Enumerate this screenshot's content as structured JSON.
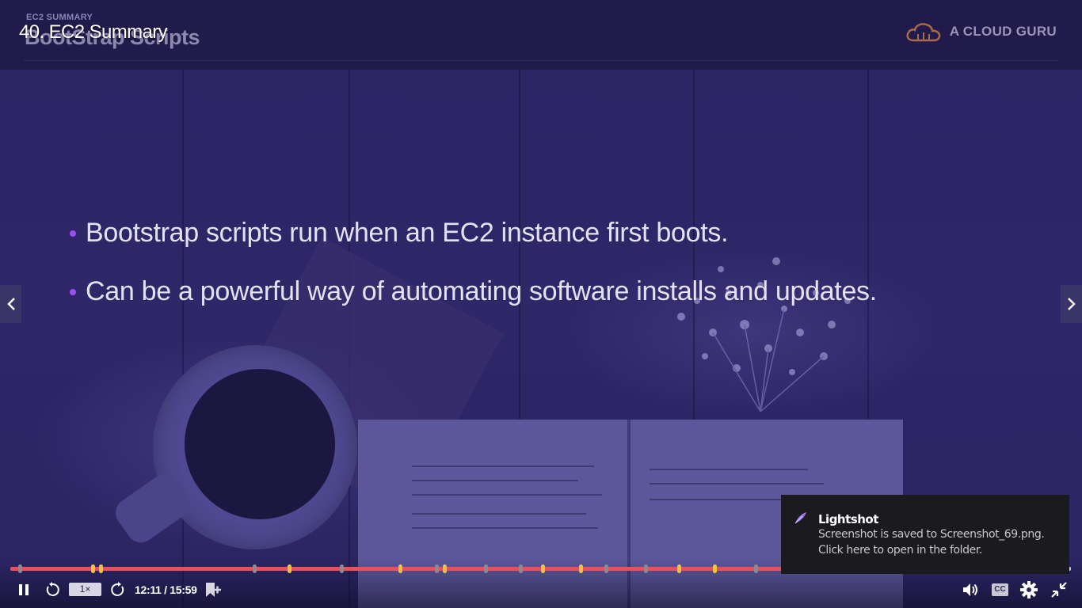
{
  "player": {
    "video_title": "40. EC2 Summary"
  },
  "slide": {
    "kicker": "EC2 SUMMARY",
    "title": "BootStrap Scripts",
    "brand": "A CLOUD GURU",
    "bullets": [
      "Bootstrap scripts run when an EC2 instance first boots.",
      "Can be a powerful way of automating software installs and updates."
    ]
  },
  "controls": {
    "speed": "1×",
    "time": "12:11 / 15:59",
    "progress_fraction": 0.762,
    "cc_label": "CC"
  },
  "toast": {
    "app": "Lightshot",
    "line1": "Screenshot is saved to Screenshot_69.png.",
    "line2": "Click here to open in the folder."
  },
  "colors": {
    "progress_played": "#e8515c",
    "marker_yellow": "#f3c53d",
    "marker_gray": "#8a8a92",
    "bullet_dot": "#9a4ff0"
  },
  "icons": {
    "pause": "pause-icon",
    "rewind": "rewind-icon",
    "forward": "forward-icon",
    "bookmark": "bookmark-add-icon",
    "volume": "volume-icon",
    "settings": "gear-icon",
    "exit_fullscreen": "exit-fullscreen-icon",
    "brand_logo": "cloud-logo-icon",
    "toast_app": "lightshot-feather-icon"
  }
}
